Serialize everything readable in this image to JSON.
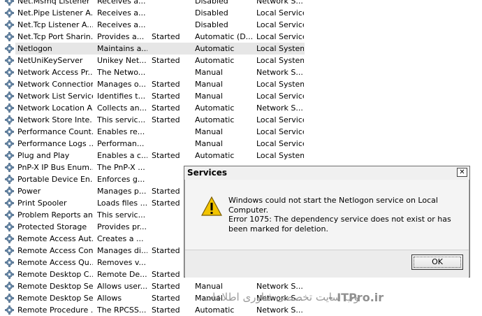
{
  "services": [
    {
      "name": "Net.Msmq Listener ...",
      "description": "Receives a...",
      "status": "",
      "startup": "Disabled",
      "logon": "Network S..."
    },
    {
      "name": "Net.Pipe Listener A...",
      "description": "Receives a...",
      "status": "",
      "startup": "Disabled",
      "logon": "Local Service"
    },
    {
      "name": "Net.Tcp Listener A...",
      "description": "Receives a...",
      "status": "",
      "startup": "Disabled",
      "logon": "Local Service"
    },
    {
      "name": "Net.Tcp Port Sharin...",
      "description": "Provides a...",
      "status": "Started",
      "startup": "Automatic (D...",
      "logon": "Local Service"
    },
    {
      "name": "Netlogon",
      "description": "Maintains a...",
      "status": "",
      "startup": "Automatic",
      "logon": "Local System",
      "selected": true
    },
    {
      "name": "NetUniKeyServer",
      "description": "Unikey Net...",
      "status": "Started",
      "startup": "Automatic",
      "logon": "Local System"
    },
    {
      "name": "Network Access Pr...",
      "description": "The Netwo...",
      "status": "",
      "startup": "Manual",
      "logon": "Network S..."
    },
    {
      "name": "Network Connections",
      "description": "Manages o...",
      "status": "Started",
      "startup": "Manual",
      "logon": "Local System"
    },
    {
      "name": "Network List Service",
      "description": "Identifies t...",
      "status": "Started",
      "startup": "Manual",
      "logon": "Local Service"
    },
    {
      "name": "Network Location A...",
      "description": "Collects an...",
      "status": "Started",
      "startup": "Automatic",
      "logon": "Network S..."
    },
    {
      "name": "Network Store Inte...",
      "description": "This servic...",
      "status": "Started",
      "startup": "Automatic",
      "logon": "Local Service"
    },
    {
      "name": "Performance Count...",
      "description": "Enables re...",
      "status": "",
      "startup": "Manual",
      "logon": "Local Service"
    },
    {
      "name": "Performance Logs ...",
      "description": "Performan...",
      "status": "",
      "startup": "Manual",
      "logon": "Local Service"
    },
    {
      "name": "Plug and Play",
      "description": "Enables a c...",
      "status": "Started",
      "startup": "Automatic",
      "logon": "Local System"
    },
    {
      "name": "PnP-X IP Bus Enum...",
      "description": "The PnP-X ...",
      "status": "",
      "startup": "",
      "logon": ""
    },
    {
      "name": "Portable Device En...",
      "description": "Enforces g...",
      "status": "",
      "startup": "",
      "logon": ""
    },
    {
      "name": "Power",
      "description": "Manages p...",
      "status": "Started",
      "startup": "",
      "logon": ""
    },
    {
      "name": "Print Spooler",
      "description": "Loads files ...",
      "status": "Started",
      "startup": "",
      "logon": ""
    },
    {
      "name": "Problem Reports an...",
      "description": "This servic...",
      "status": "",
      "startup": "",
      "logon": ""
    },
    {
      "name": "Protected Storage",
      "description": "Provides pr...",
      "status": "",
      "startup": "",
      "logon": ""
    },
    {
      "name": "Remote Access Aut...",
      "description": "Creates a ...",
      "status": "",
      "startup": "",
      "logon": ""
    },
    {
      "name": "Remote Access Con...",
      "description": "Manages di...",
      "status": "Started",
      "startup": "",
      "logon": ""
    },
    {
      "name": "Remote Access Qu...",
      "description": "Removes v...",
      "status": "",
      "startup": "",
      "logon": ""
    },
    {
      "name": "Remote Desktop C...",
      "description": "Remote De...",
      "status": "Started",
      "startup": "",
      "logon": ""
    },
    {
      "name": "Remote Desktop Se...",
      "description": "Allows user...",
      "status": "Started",
      "startup": "Manual",
      "logon": "Network S..."
    },
    {
      "name": "Remote Desktop Se...",
      "description": "Allows",
      "status": "Started",
      "startup": "Manual",
      "logon": "Network S..."
    },
    {
      "name": "Remote Procedure ...",
      "description": "The RPCSS...",
      "status": "Started",
      "startup": "Automatic",
      "logon": "Network S..."
    }
  ],
  "dialog": {
    "title": "Services",
    "close_glyph": "✕",
    "message": "Windows could not start the Netlogon service on Local Computer.",
    "error": "Error 1075: The dependency service does not exist or has been marked for deletion.",
    "ok_label": "OK"
  },
  "watermark": {
    "text": "وب سایت تخصصی فناوری اطلاعات",
    "brand": "- ITPro.ir"
  },
  "icons": {
    "service": "gear-icon",
    "warning": "warning-icon"
  }
}
